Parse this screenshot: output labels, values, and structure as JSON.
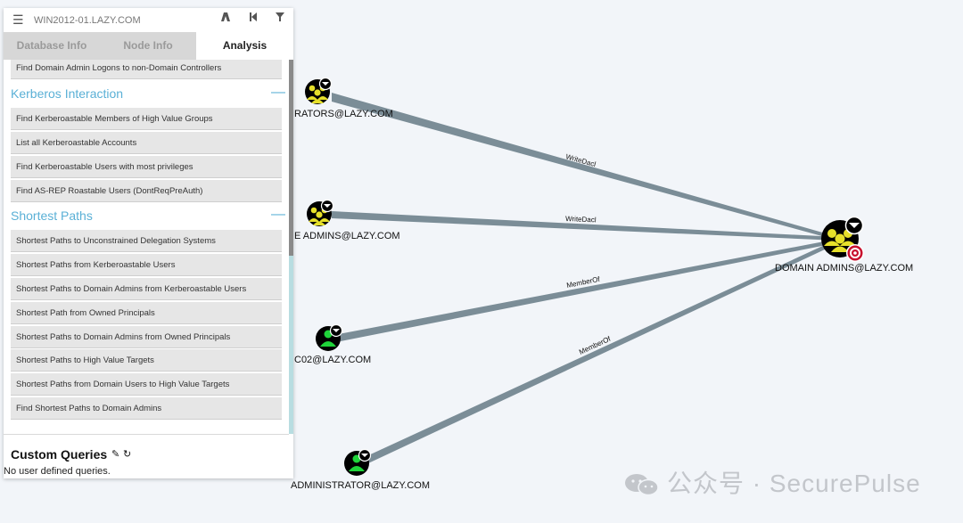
{
  "search": {
    "value": "WIN2012-01.LAZY.COM"
  },
  "toolbar": {
    "path_icon": "path-finding-icon",
    "back_icon": "back-icon",
    "filter_icon": "filter-icon"
  },
  "tabs": [
    {
      "label": "Database Info",
      "active": false
    },
    {
      "label": "Node Info",
      "active": false
    },
    {
      "label": "Analysis",
      "active": true
    }
  ],
  "queries": {
    "top_item": "Find Domain Admin Logons to non-Domain Controllers",
    "sections": [
      {
        "title": "Kerberos Interaction",
        "collapse": "—",
        "items": [
          "Find Kerberoastable Members of High Value Groups",
          "List all Kerberoastable Accounts",
          "Find Kerberoastable Users with most privileges",
          "Find AS-REP Roastable Users (DontReqPreAuth)"
        ]
      },
      {
        "title": "Shortest Paths",
        "collapse": "—",
        "items": [
          "Shortest Paths to Unconstrained Delegation Systems",
          "Shortest Paths from Kerberoastable Users",
          "Shortest Paths to Domain Admins from Kerberoastable Users",
          "Shortest Path from Owned Principals",
          "Shortest Paths to Domain Admins from Owned Principals",
          "Shortest Paths to High Value Targets",
          "Shortest Paths from Domain Users to High Value Targets",
          "Find Shortest Paths to Domain Admins"
        ]
      }
    ]
  },
  "custom_queries": {
    "title": "Custom Queries",
    "empty": "No user defined queries."
  },
  "graph": {
    "colors": {
      "edge": "#7b8d97",
      "group": "#e6e02a",
      "user": "#1fd43a",
      "node_bg": "#000",
      "target": "#c8102e"
    },
    "nodes": [
      {
        "id": "administrators",
        "label": "RATORS@LAZY.COM",
        "type": "group",
        "icon": "group-icon"
      },
      {
        "id": "enterprise_admins",
        "label": "E ADMINS@LAZY.COM",
        "type": "group",
        "icon": "group-icon"
      },
      {
        "id": "dc02",
        "label": "C02@LAZY.COM",
        "type": "user",
        "icon": "user-icon"
      },
      {
        "id": "administrator",
        "label": "ADMINISTRATOR@LAZY.COM",
        "type": "user",
        "icon": "user-icon"
      },
      {
        "id": "domain_admins",
        "label": "DOMAIN ADMINS@LAZY.COM",
        "type": "group",
        "icon": "group-icon",
        "high_value": true
      }
    ],
    "edges": [
      {
        "from": "administrators",
        "to": "domain_admins",
        "label": "WriteDacl"
      },
      {
        "from": "enterprise_admins",
        "to": "domain_admins",
        "label": "WriteDacl"
      },
      {
        "from": "dc02",
        "to": "domain_admins",
        "label": "MemberOf"
      },
      {
        "from": "administrator",
        "to": "domain_admins",
        "label": "MemberOf"
      }
    ]
  },
  "watermark": {
    "text": "公众号 · SecurePulse"
  }
}
